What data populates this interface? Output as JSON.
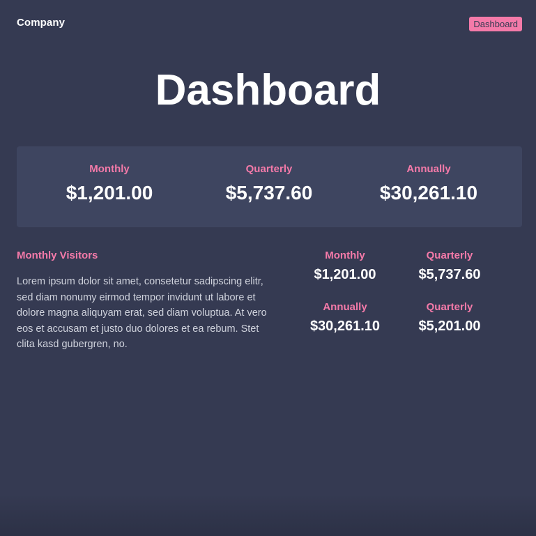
{
  "header": {
    "brand": "Company",
    "nav_badge": "Dashboard"
  },
  "page_title": "Dashboard",
  "summary_stats": [
    {
      "label": "Monthly",
      "value": "$1,201.00"
    },
    {
      "label": "Quarterly",
      "value": "$5,737.60"
    },
    {
      "label": "Annually",
      "value": "$30,261.10"
    }
  ],
  "visitors": {
    "title": "Monthly Visitors",
    "text": "Lorem ipsum dolor sit amet, consetetur sadipscing elitr, sed diam nonumy eirmod tempor invidunt ut labore et dolore magna aliquyam erat, sed diam voluptua. At vero eos et accusam et justo duo dolores et ea rebum. Stet clita kasd gubergren, no."
  },
  "mini_stats": [
    {
      "label": "Monthly",
      "value": "$1,201.00"
    },
    {
      "label": "Quarterly",
      "value": "$5,737.60"
    },
    {
      "label": "Annually",
      "value": "$30,261.10"
    },
    {
      "label": "Quarterly",
      "value": "$5,201.00"
    }
  ],
  "colors": {
    "background": "#353a52",
    "panel": "#3e4560",
    "accent": "#f47aa9",
    "text": "#ffffff"
  }
}
